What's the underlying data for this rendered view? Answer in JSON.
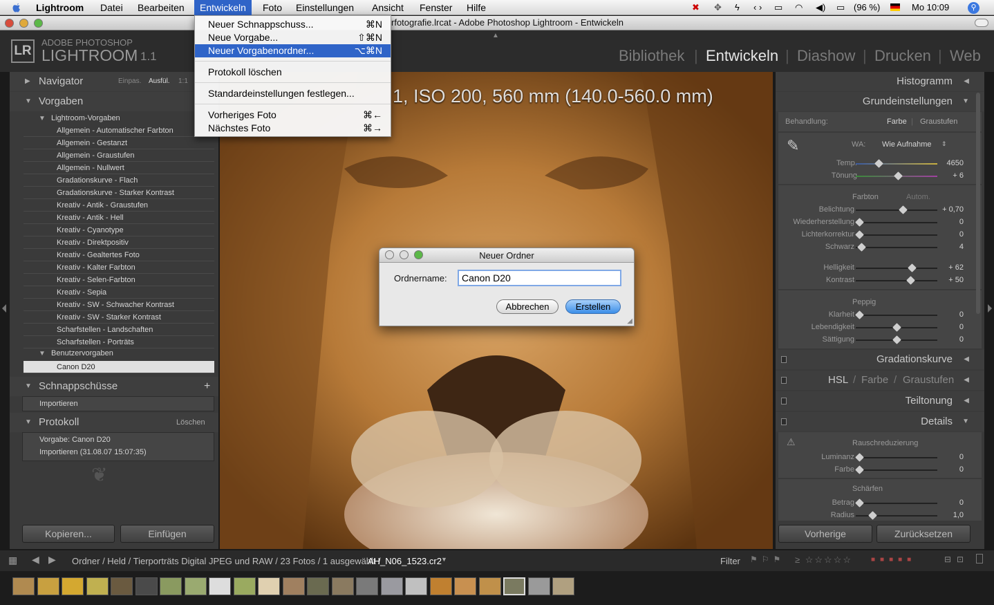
{
  "menubar": {
    "app": "Lightroom",
    "items": [
      "Datei",
      "Bearbeiten",
      "Entwickeln",
      "Foto",
      "Einstellungen",
      "Ansicht",
      "Fenster",
      "Hilfe"
    ],
    "battery": "(96 %)",
    "clock": "Mo 10:09"
  },
  "window": {
    "title": "rfotografie.lrcat - Adobe Photoshop Lightroom - Entwickeln"
  },
  "logo": {
    "badge": "LR",
    "line1": "ADOBE PHOTOSHOP",
    "line2": "LIGHTROOM",
    "version": "1.1"
  },
  "modules": [
    "Bibliothek",
    "Entwickeln",
    "Diashow",
    "Drucken",
    "Web"
  ],
  "dropdown": {
    "items": [
      {
        "label": "Neuer Schnappschuss...",
        "shortcut": "⌘N"
      },
      {
        "label": "Neue Vorgabe...",
        "shortcut": "⇧⌘N"
      },
      {
        "label": "Neuer Vorgabenordner...",
        "shortcut": "⌥⌘N"
      },
      {
        "label": "Protokoll löschen",
        "shortcut": ""
      },
      {
        "label": "Standardeinstellungen festlegen...",
        "shortcut": ""
      },
      {
        "label": "Vorheriges Foto",
        "shortcut": "⌘←"
      },
      {
        "label": "Nächstes Foto",
        "shortcut": "⌘→"
      }
    ]
  },
  "left": {
    "navigator": {
      "title": "Navigator",
      "opt1": "Einpas.",
      "opt2": "Ausfül.",
      "opt3": "1:1"
    },
    "vorgaben": {
      "title": "Vorgaben",
      "group1": "Lightroom-Vorgaben",
      "presets": [
        "Allgemein - Automatischer Farbton",
        "Allgemein - Gestanzt",
        "Allgemein - Graustufen",
        "Allgemein - Nullwert",
        "Gradationskurve - Flach",
        "Gradationskurve - Starker Kontrast",
        "Kreativ - Antik - Graustufen",
        "Kreativ - Antik - Hell",
        "Kreativ - Cyanotype",
        "Kreativ - Direktpositiv",
        "Kreativ - Gealtertes Foto",
        "Kreativ - Kalter Farbton",
        "Kreativ - Selen-Farbton",
        "Kreativ - Sepia",
        "Kreativ - SW - Schwacher Kontrast",
        "Kreativ - SW - Starker Kontrast",
        "Scharfstellen - Landschaften",
        "Scharfstellen - Porträts"
      ],
      "group2": "Benutzervorgaben",
      "user_preset": "Canon D20"
    },
    "snapshots": {
      "title": "Schnappschüsse",
      "plus": "+",
      "item": "Importieren"
    },
    "protokoll": {
      "title": "Protokoll",
      "clear": "Löschen",
      "items": [
        "Vorgabe: Canon D20",
        "Importieren (31.08.07 15:07:35)"
      ]
    },
    "copy_btn": "Kopieren...",
    "paste_btn": "Einfügen"
  },
  "center": {
    "overlay": "1, ISO 200, 560 mm (140.0-560.0 mm)"
  },
  "dialog": {
    "title": "Neuer Ordner",
    "label": "Ordnername:",
    "value": "Canon D20",
    "cancel": "Abbrechen",
    "ok": "Erstellen"
  },
  "right": {
    "histogram": "Histogramm",
    "basic": {
      "title": "Grundeinstellungen",
      "treatment_label": "Behandlung:",
      "color": "Farbe",
      "gray": "Graustufen",
      "wb_label": "WA:",
      "wb_value": "Wie Aufnahme",
      "temp_label": "Temp.",
      "temp_value": "4650",
      "temp_pos": 0.28,
      "tint_label": "Tönung",
      "tint_value": "+ 6",
      "tint_pos": 0.52,
      "tone_label": "Farbton",
      "auto": "Autom.",
      "exposure_label": "Belichtung",
      "exposure_value": "+ 0,70",
      "exposure_pos": 0.58,
      "recovery_label": "Wiederherstellung",
      "recovery_value": "0",
      "recovery_pos": 0.04,
      "fill_label": "Lichterkorrektur",
      "fill_value": "0",
      "fill_pos": 0.04,
      "black_label": "Schwarz",
      "black_value": "4",
      "black_pos": 0.07,
      "brightness_label": "Helligkeit",
      "brightness_value": "+ 62",
      "brightness_pos": 0.69,
      "contrast_label": "Kontrast",
      "contrast_value": "+ 50",
      "contrast_pos": 0.67,
      "presence_label": "Peppig",
      "clarity_label": "Klarheit",
      "clarity_value": "0",
      "clarity_pos": 0.04,
      "vibrance_label": "Lebendigkeit",
      "vibrance_value": "0",
      "vibrance_pos": 0.5,
      "saturation_label": "Sättigung",
      "saturation_value": "0",
      "saturation_pos": 0.5
    },
    "curve": "Gradationskurve",
    "hsl": {
      "a": "HSL",
      "b": "Farbe",
      "c": "Graustufen",
      "slash": "/"
    },
    "split": "Teiltonung",
    "details": {
      "title": "Details",
      "noise_title": "Rauschreduzierung",
      "lum_label": "Luminanz",
      "lum_value": "0",
      "lum_pos": 0.04,
      "color_label": "Farbe",
      "color_value": "0",
      "color_pos": 0.04,
      "sharpen_title": "Schärfen",
      "amount_label": "Betrag",
      "amount_value": "0",
      "amount_pos": 0.04,
      "radius_label": "Radius",
      "radius_value": "1,0",
      "radius_pos": 0.2
    },
    "prev_btn": "Vorherige",
    "reset_btn": "Zurücksetzen"
  },
  "bottom": {
    "breadcrumb": "Ordner / Held / Tierporträts Digital JPEG und RAW / 23 Fotos / 1 ausgewählt /",
    "filename": "AH_N06_1523.cr2",
    "filter": "Filter"
  },
  "colors": {
    "accent": "#2f64c8",
    "panel": "#3a3a3a",
    "dark": "#2c2c2c"
  }
}
